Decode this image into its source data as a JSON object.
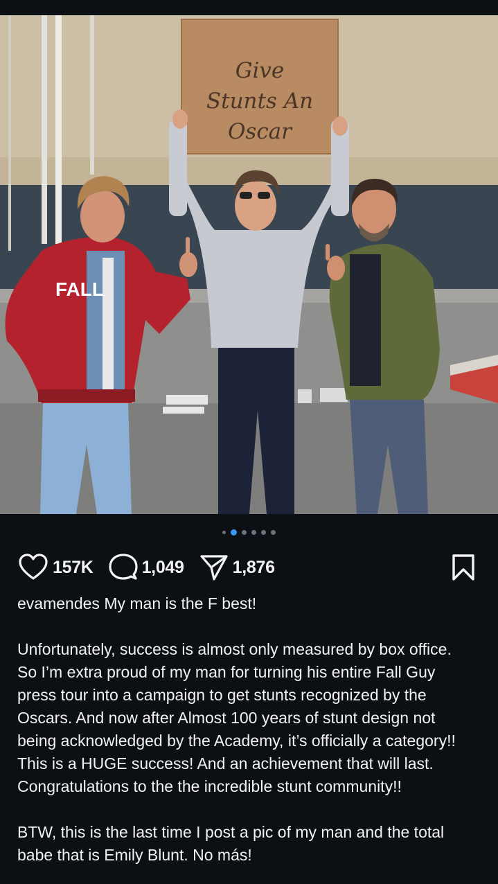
{
  "post": {
    "sign_lines": [
      "Give",
      "Stunts An",
      "Oscar"
    ],
    "jacket_text": "FALL",
    "carousel": {
      "total": 6,
      "active_index": 1
    }
  },
  "actions": {
    "likes": "157K",
    "comments": "1,049",
    "shares": "1,876"
  },
  "caption": {
    "username": "evamendes",
    "first_line": "My man is the F best!",
    "paragraph_1_lines": [
      "Unfortunately, success is almost only measured by box office.",
      "So I’m extra proud of my man for turning his entire Fall Guy",
      "press tour into a campaign to get stunts recognized by the",
      "Oscars. And now after Almost 100 years of stunt design not",
      "being acknowledged by the Academy, it’s officially a category!!",
      "This is a HUGE success! And an achievement that will last.",
      "Congratulations to the the incredible stunt community!!"
    ],
    "paragraph_2_lines": [
      "BTW, this is the last time I post a pic of my man and the total",
      "babe that is Emily Blunt. No más!"
    ]
  },
  "colors": {
    "background": "#0c0f14",
    "accent_blue": "#3897f0",
    "text": "#f2f2f2"
  }
}
